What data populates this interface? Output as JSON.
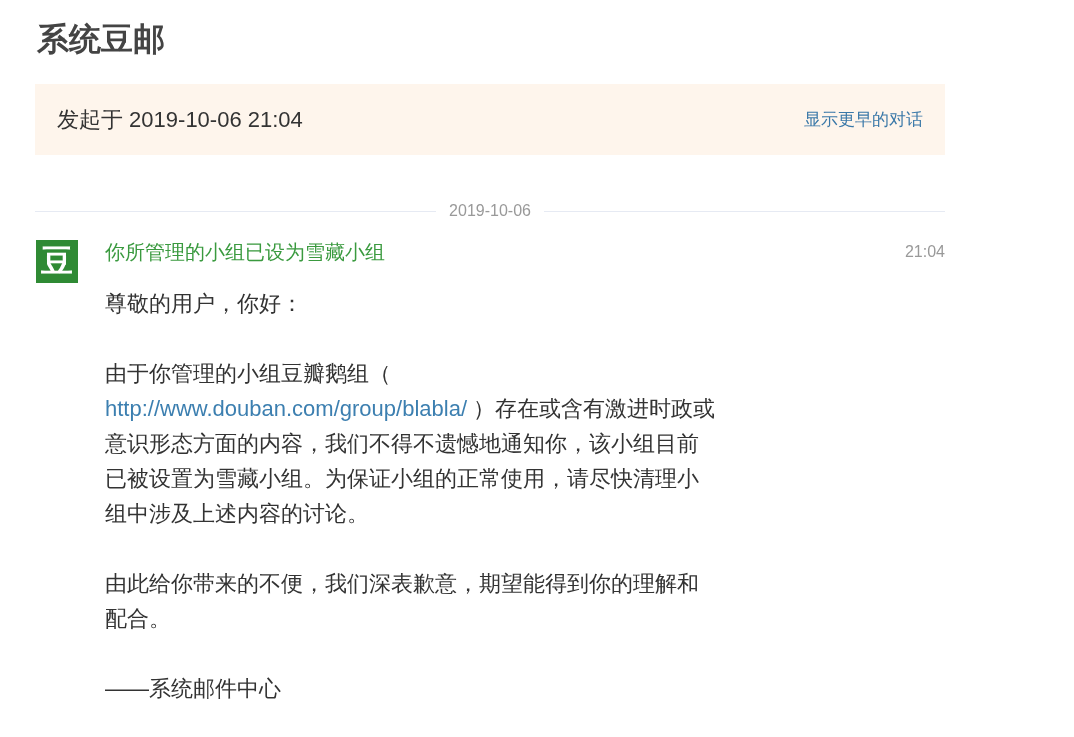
{
  "page_title": "系统豆邮",
  "conversation_banner": {
    "started": "发起于 2019-10-06 21:04",
    "earlier_link": "显示更早的对话"
  },
  "date_divider": "2019-10-06",
  "messages": [
    {
      "avatar_text": "豆",
      "subject": "你所管理的小组已设为雪藏小组",
      "time": "21:04",
      "body": [
        {
          "kind": "text",
          "text": "尊敬的用户，你好："
        },
        {
          "kind": "text_with_link",
          "before": "由于你管理的小组豆瓣鹅组（ ",
          "link": "http://www.douban.com/group/blabla/",
          "after": " ）存在或含有激进时政或意识形态方面的内容，我们不得不遗憾地通知你，该小组目前已被设置为雪藏小组。为保证小组的正常使用，请尽快清理小组中涉及上述内容的讨论。"
        },
        {
          "kind": "text",
          "text": "由此给你带来的不便，我们深表歉意，期望能得到你的理解和配合。"
        },
        {
          "kind": "text",
          "text": "——系统邮件中心"
        }
      ]
    }
  ]
}
